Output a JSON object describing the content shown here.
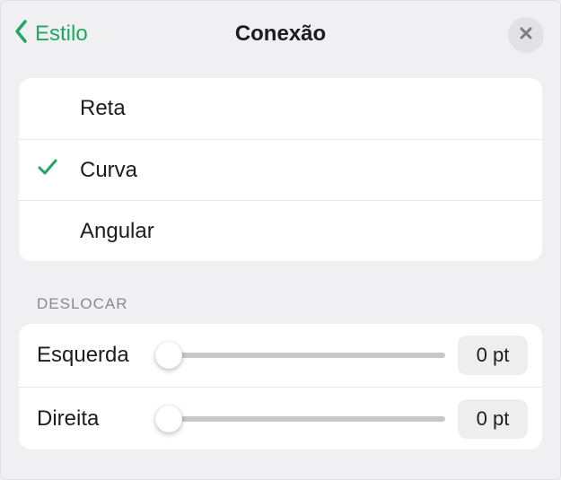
{
  "header": {
    "back_label": "Estilo",
    "title": "Conexão"
  },
  "line_type": {
    "options": [
      {
        "label": "Reta",
        "selected": false
      },
      {
        "label": "Curva",
        "selected": true
      },
      {
        "label": "Angular",
        "selected": false
      }
    ]
  },
  "offset": {
    "section_label": "DESLOCAR",
    "left": {
      "label": "Esquerda",
      "value": 0,
      "display": "0 pt"
    },
    "right": {
      "label": "Direita",
      "value": 0,
      "display": "0 pt"
    }
  },
  "colors": {
    "accent": "#1fa862"
  }
}
